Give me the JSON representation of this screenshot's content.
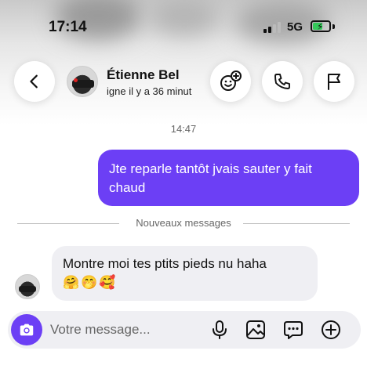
{
  "status_bar": {
    "time": "17:14",
    "network": "5G",
    "battery_level": 0.55,
    "battery_color": "#34c759"
  },
  "header": {
    "contact_name": "Étienne Bel",
    "contact_status": "igne il y a 36 minut",
    "icons": [
      "back-arrow-icon",
      "emoji-add-icon",
      "phone-icon",
      "flag-icon"
    ]
  },
  "chat": {
    "timestamp": "14:47",
    "outgoing": {
      "text": "Jte reparle tantôt jvais sauter y fait chaud",
      "color": "#6c3ff5"
    },
    "new_messages_label": "Nouveaux messages",
    "incoming": {
      "text": "Montre moi tes ptits pieds nu  haha",
      "emojis": "🤗🤭🥰",
      "color": "#efeff3"
    }
  },
  "composer": {
    "placeholder": "Votre message...",
    "icons": [
      "camera-icon",
      "microphone-icon",
      "image-icon",
      "chat-bubble-icon",
      "plus-icon"
    ]
  }
}
